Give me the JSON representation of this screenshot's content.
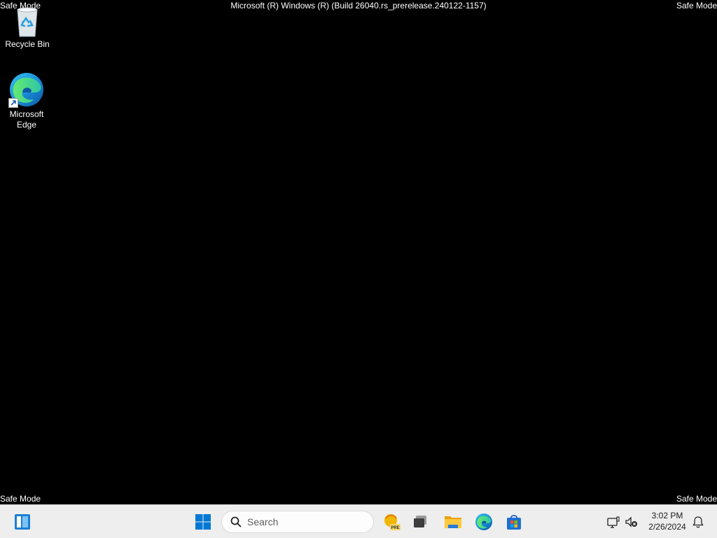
{
  "overlay": {
    "safe_mode_top_left": "Safe Mode",
    "safe_mode_top_right": "Safe Mode",
    "safe_mode_bottom_left": "Safe Mode",
    "safe_mode_bottom_right": "Safe Mode",
    "build_string": "Microsoft (R) Windows (R) (Build 26040.rs_prerelease.240122-1157)"
  },
  "desktop": {
    "icons": [
      {
        "label": "Recycle Bin",
        "icon": "recycle-bin-icon"
      },
      {
        "label": "Microsoft Edge",
        "icon": "edge-icon",
        "shortcut": true
      }
    ]
  },
  "taskbar": {
    "search_placeholder": "Search",
    "pinned": [
      "widgets-icon",
      "windows-start-icon",
      "copilot-icon",
      "task-view-icon",
      "file-explorer-icon",
      "edge-icon",
      "microsoft-store-icon"
    ],
    "tray": {
      "time": "3:02 PM",
      "date": "2/26/2024",
      "icons": [
        "network-icon",
        "volume-muted-icon",
        "notification-bell-icon"
      ]
    }
  },
  "colors": {
    "desktop_bg": "#000000",
    "taskbar_bg": "#eeeeee",
    "windows_blue": "#0078d4"
  }
}
